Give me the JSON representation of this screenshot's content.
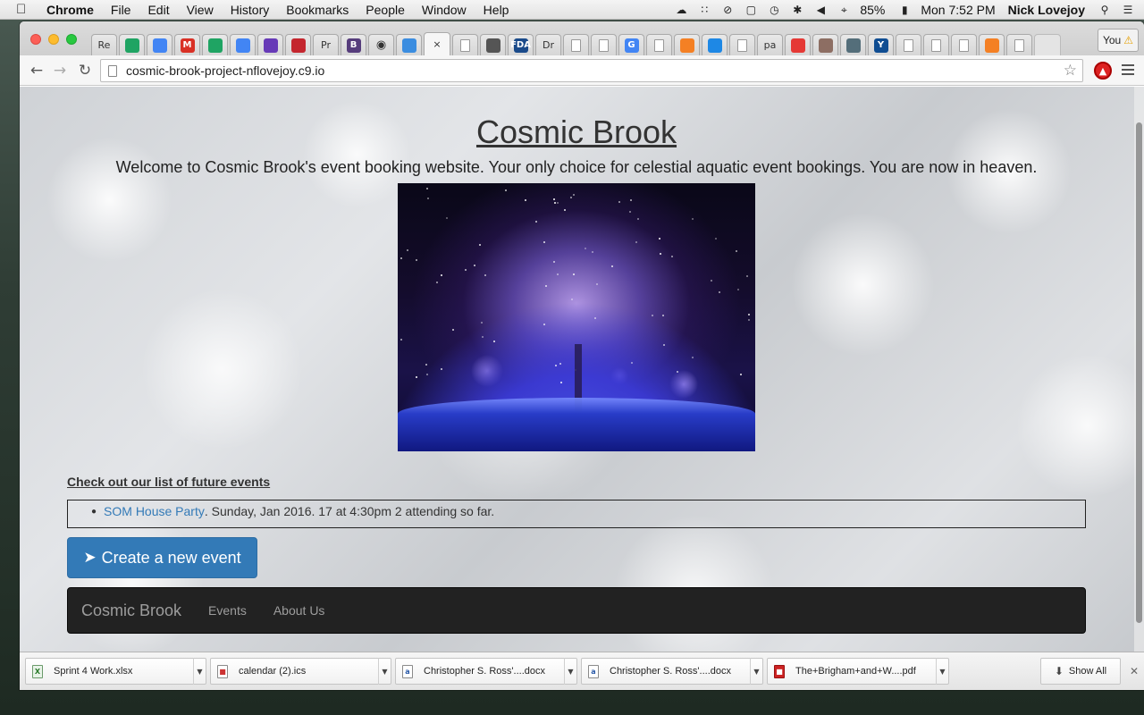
{
  "menubar": {
    "app_name": "Chrome",
    "items": [
      "File",
      "Edit",
      "View",
      "History",
      "Bookmarks",
      "People",
      "Window",
      "Help"
    ],
    "battery": "85%",
    "clock": "Mon 7:52 PM",
    "user": "Nick Lovejoy"
  },
  "tabs": [
    {
      "label": "Re",
      "kind": "text"
    },
    {
      "label": "",
      "kind": "drive",
      "color": "#1fa463"
    },
    {
      "label": "",
      "kind": "docs",
      "color": "#4285f4"
    },
    {
      "label": "M",
      "kind": "gmail",
      "color": "#d93025"
    },
    {
      "label": "",
      "kind": "drive",
      "color": "#1fa463"
    },
    {
      "label": "",
      "kind": "docs",
      "color": "#4285f4"
    },
    {
      "label": "",
      "kind": "forms",
      "color": "#673ab7"
    },
    {
      "label": "",
      "kind": "app",
      "color": "#c4262e"
    },
    {
      "label": "Pr",
      "kind": "text"
    },
    {
      "label": "B",
      "kind": "bootstrap",
      "color": "#563d7c"
    },
    {
      "label": "",
      "kind": "github",
      "color": "#222222"
    },
    {
      "label": "",
      "kind": "app",
      "color": "#3b8de0"
    },
    {
      "label": "×",
      "kind": "active"
    },
    {
      "label": "",
      "kind": "doc"
    },
    {
      "label": "",
      "kind": "app",
      "color": "#555555"
    },
    {
      "label": "FDA",
      "kind": "app",
      "color": "#1a4a8a"
    },
    {
      "label": "Dr",
      "kind": "text"
    },
    {
      "label": "",
      "kind": "doc"
    },
    {
      "label": "",
      "kind": "doc"
    },
    {
      "label": "G",
      "kind": "google",
      "color": "#4285f4"
    },
    {
      "label": "",
      "kind": "doc"
    },
    {
      "label": "",
      "kind": "app",
      "color": "#f48024"
    },
    {
      "label": "",
      "kind": "app",
      "color": "#1e88e5"
    },
    {
      "label": "",
      "kind": "doc"
    },
    {
      "label": "pa",
      "kind": "text"
    },
    {
      "label": "",
      "kind": "app",
      "color": "#e53935"
    },
    {
      "label": "",
      "kind": "app",
      "color": "#8d6e63"
    },
    {
      "label": "",
      "kind": "app",
      "color": "#546e7a"
    },
    {
      "label": "Y",
      "kind": "yale",
      "color": "#0f4d92"
    },
    {
      "label": "",
      "kind": "doc"
    },
    {
      "label": "",
      "kind": "doc"
    },
    {
      "label": "",
      "kind": "doc"
    },
    {
      "label": "",
      "kind": "app",
      "color": "#f48024"
    },
    {
      "label": "",
      "kind": "doc"
    },
    {
      "label": "",
      "kind": "newtab"
    }
  ],
  "profile": {
    "label": "You"
  },
  "toolbar": {
    "url": "cosmic-brook-project-nflovejoy.c9.io"
  },
  "page": {
    "title": "Cosmic Brook",
    "subtitle": "Welcome to Cosmic Brook's event booking website. Your only choice for celestial aquatic event bookings. You are now in heaven.",
    "events_heading": "Check out our list of future events",
    "events": [
      {
        "name": "SOM House Party",
        "details": ". Sunday, Jan 2016. 17 at 4:30pm 2 attending so far."
      }
    ],
    "create_button": "Create a new event",
    "navbar": {
      "brand": "Cosmic Brook",
      "links": [
        "Events",
        "About Us"
      ]
    }
  },
  "downloads": [
    {
      "name": "Sprint 4 Work.xlsx",
      "type": "xlsx"
    },
    {
      "name": "calendar (2).ics",
      "type": "ics"
    },
    {
      "name": "Christopher S. Ross'....docx",
      "type": "docx"
    },
    {
      "name": "Christopher S. Ross'....docx",
      "type": "docx"
    },
    {
      "name": "The+Brigham+and+W....pdf",
      "type": "pdf"
    }
  ],
  "show_all": "Show All"
}
